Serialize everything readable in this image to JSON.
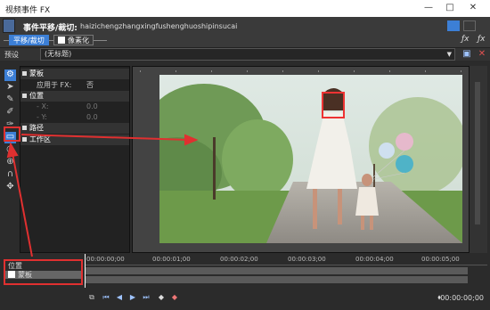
{
  "window": {
    "title": "视频事件 FX",
    "minimize": "—",
    "maximize": "□",
    "close": "✕"
  },
  "header": {
    "title": "事件平移/裁切:",
    "subtitle": "haizichengzhangxingfushenghuoshipinsucai",
    "chain": [
      {
        "label": "平移/裁切",
        "active": true
      },
      {
        "label": "像素化",
        "checked": true
      }
    ]
  },
  "preset": {
    "label": "预设",
    "value": "(无标题)",
    "save_icon": "save-icon",
    "delete_icon": "delete-icon"
  },
  "properties": {
    "sections": [
      {
        "title": "蒙板",
        "rows": [
          {
            "key": "应用于 FX:",
            "value": "否"
          }
        ]
      },
      {
        "title": "位置",
        "rows": [
          {
            "key": "X:",
            "value": "0.0"
          },
          {
            "key": "Y:",
            "value": "0.0"
          }
        ]
      },
      {
        "title": "路径",
        "rows": []
      },
      {
        "title": "工作区",
        "rows": []
      }
    ]
  },
  "timeline": {
    "labels": [
      "位置",
      "蒙板"
    ],
    "ticks": [
      "00:00:00;00",
      "00:00:01;00",
      "00:00:02;00",
      "00:00:03;00",
      "00:00:04;00",
      "00:00:05;00"
    ],
    "timecode": "00:00:00;00"
  },
  "colors": {
    "accent": "#3c7fd6",
    "annotation": "#e03030"
  }
}
